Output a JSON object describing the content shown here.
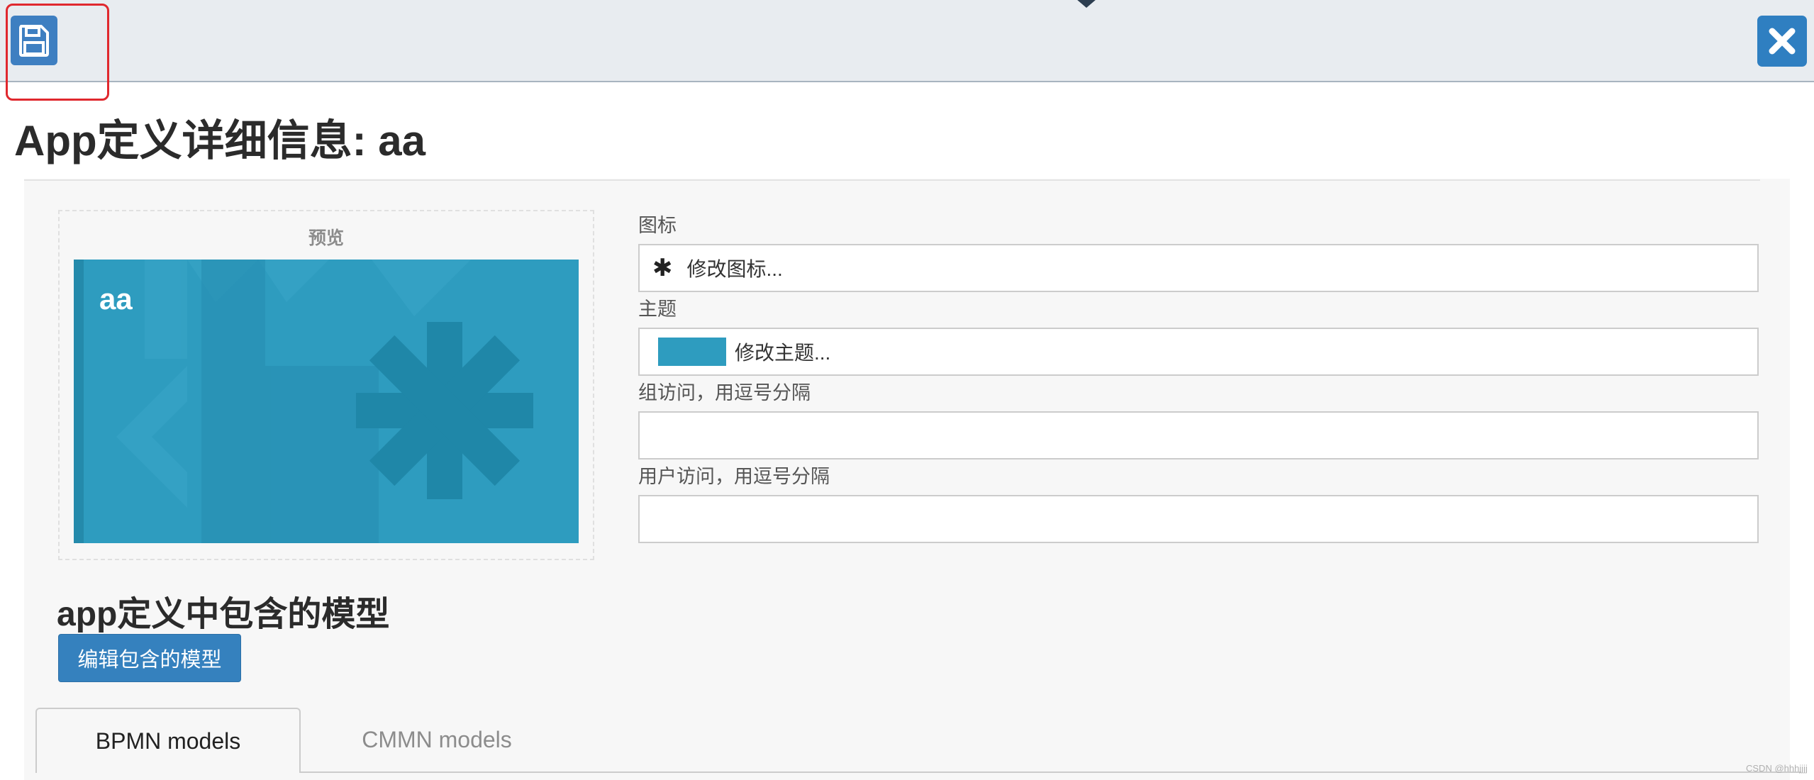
{
  "page": {
    "title": "App定义详细信息: aa"
  },
  "toolbar": {
    "save_icon": "floppy-disk-icon",
    "close_icon": "close-x-icon"
  },
  "preview": {
    "label": "预览",
    "app_name": "aa",
    "theme_color": "#2e9cbf",
    "icon": "asterisk-icon"
  },
  "form": {
    "icon_label": "图标",
    "icon_button": "修改图标...",
    "theme_label": "主题",
    "theme_button": "修改主题...",
    "group_access_label": "组访问，用逗号分隔",
    "group_access_value": "",
    "user_access_label": "用户访问，用逗号分隔",
    "user_access_value": ""
  },
  "models": {
    "heading": "app定义中包含的模型",
    "edit_button": "编辑包含的模型",
    "tabs": [
      {
        "label": "BPMN models",
        "active": true
      },
      {
        "label": "CMMN models",
        "active": false
      }
    ]
  },
  "watermark": "CSDN @hhhjjjj",
  "colors": {
    "accent_blue": "#3581be",
    "theme_teal": "#2e9cbf",
    "highlight_red": "#e0282e"
  }
}
